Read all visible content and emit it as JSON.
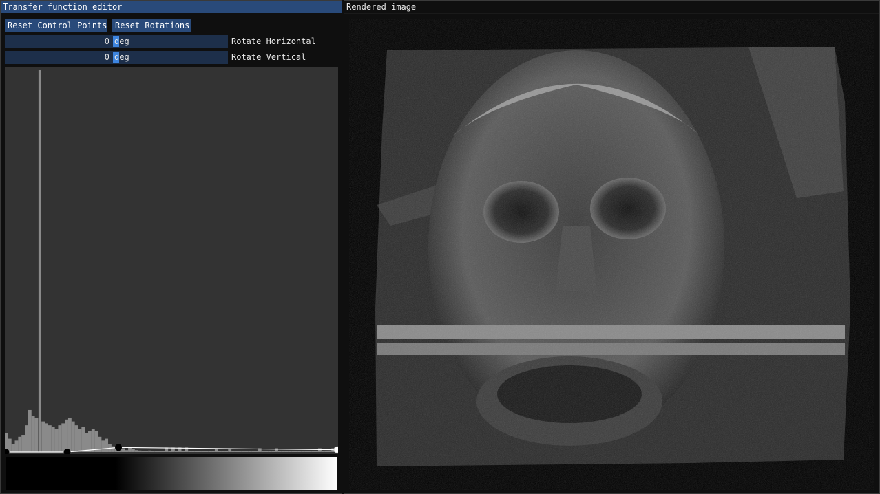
{
  "tf_window": {
    "title": "Transfer function editor",
    "reset_control_points_label": "Reset Control Points",
    "reset_rotations_label": "Reset Rotations",
    "rotate_horizontal": {
      "value": "0",
      "unit": "deg",
      "label": "Rotate Horizontal"
    },
    "rotate_vertical": {
      "value": "0",
      "unit": "deg",
      "label": "Rotate Vertical"
    },
    "histogram": {
      "spike_bin": 10,
      "bins": [
        0.05,
        0.035,
        0.02,
        0.03,
        0.04,
        0.045,
        0.07,
        0.11,
        0.095,
        0.09,
        1.0,
        0.08,
        0.075,
        0.07,
        0.065,
        0.06,
        0.07,
        0.075,
        0.085,
        0.09,
        0.08,
        0.07,
        0.06,
        0.065,
        0.05,
        0.055,
        0.06,
        0.055,
        0.04,
        0.03,
        0.035,
        0.02,
        0.015,
        0.01,
        0.012,
        0.01,
        0.005,
        0.012,
        0.008,
        0.005,
        0.004,
        0.003,
        0.002,
        0.004,
        0.003,
        0.003,
        0.002,
        0.002,
        0.012,
        0.003,
        0.012,
        0.002,
        0.012,
        0.002,
        0.012,
        0.002,
        0.003,
        0.003,
        0.002,
        0.002,
        0.002,
        0.002,
        0.002,
        0.01,
        0.002,
        0.002,
        0.003,
        0.01,
        0.002,
        0.002,
        0.002,
        0.002,
        0.002,
        0.002,
        0.002,
        0.003,
        0.01,
        0.002,
        0.002,
        0.002,
        0.002,
        0.01,
        0.002,
        0.002,
        0.002,
        0.002,
        0.002,
        0.002,
        0.002,
        0.002,
        0.002,
        0.002,
        0.002,
        0.002,
        0.01,
        0.002,
        0.002,
        0.002,
        0.01,
        0.002
      ]
    },
    "control_points": [
      {
        "position": 0.0,
        "opacity": 0.0
      },
      {
        "position": 0.185,
        "opacity": 0.0
      },
      {
        "position": 0.34,
        "opacity": 0.012
      },
      {
        "position": 1.0,
        "opacity": 0.006
      }
    ],
    "colors": {
      "accent": "#294a7a",
      "slider_grab": "#3d85e0",
      "frame_bg": "#1d2f4a",
      "editor_bg": "#333333",
      "histogram": "#8a8a8a"
    }
  },
  "render_window": {
    "title": "Rendered image"
  }
}
